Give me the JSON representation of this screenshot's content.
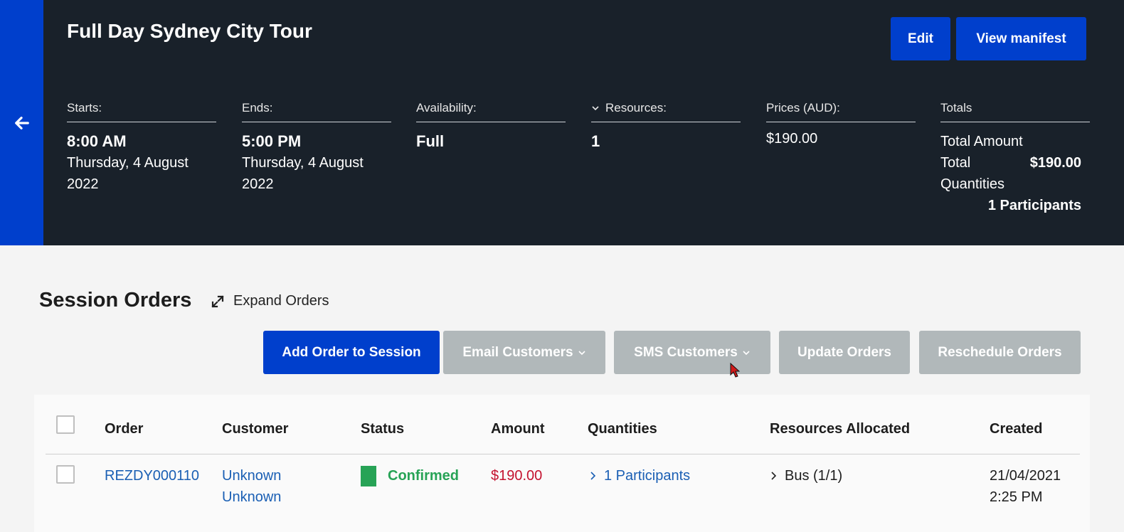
{
  "header": {
    "title": "Full Day Sydney City Tour",
    "edit_label": "Edit",
    "manifest_label": "View manifest",
    "back_icon": "arrow-left-icon",
    "starts": {
      "label": "Starts:",
      "time": "8:00 AM",
      "date": "Thursday, 4 August 2022"
    },
    "ends": {
      "label": "Ends:",
      "time": "5:00 PM",
      "date": "Thursday, 4 August 2022"
    },
    "availability": {
      "label": "Availability:",
      "value": "Full"
    },
    "resources": {
      "label": "Resources:",
      "value": "1"
    },
    "prices": {
      "label": "Prices (AUD):",
      "value": "$190.00"
    },
    "totals": {
      "label": "Totals",
      "amount_label": "Total Amount",
      "total_label": "Total",
      "total_value": "$190.00",
      "quantities_label": "Quantities",
      "quantities_value": "1 Participants"
    }
  },
  "orders": {
    "title": "Session Orders",
    "expand_label": "Expand Orders",
    "actions": {
      "add": "Add Order to Session",
      "email": "Email Customers",
      "sms": "SMS Customers",
      "update": "Update Orders",
      "reschedule": "Reschedule Orders"
    },
    "columns": [
      "Order",
      "Customer",
      "Status",
      "Amount",
      "Quantities",
      "Resources Allocated",
      "Created"
    ],
    "rows": [
      {
        "order": "REZDY000110",
        "customer_first": "Unknown",
        "customer_last": "Unknown",
        "status": "Confirmed",
        "amount": "$190.00",
        "quantities": "1 Participants",
        "resources": "Bus (1/1)",
        "created_date": "21/04/2021",
        "created_time": "2:25 PM"
      }
    ]
  },
  "colors": {
    "brand_blue": "#003fcc",
    "header_bg": "#19212a",
    "disabled_grey": "#b1b8ba",
    "confirmed_green": "#27a356",
    "amount_red": "#c4122f",
    "link_blue": "#1a5fb4"
  }
}
